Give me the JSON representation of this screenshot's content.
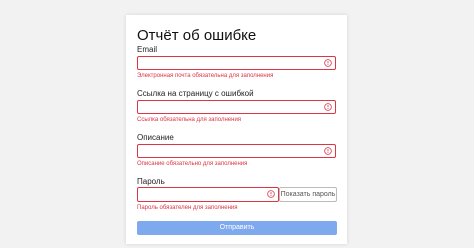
{
  "form": {
    "title": "Отчёт об ошибке",
    "fields": [
      {
        "label": "Email",
        "value": "",
        "error": "Электронная почта обязательна для заполнения",
        "icon": "error-circle-icon"
      },
      {
        "label": "Ссылка на страницу с ошибкой",
        "value": "",
        "error": "Ссылка обязательна для заполнения",
        "icon": "error-circle-icon"
      },
      {
        "label": "Описание",
        "value": "",
        "error": "Описание обязательно для заполнения",
        "icon": "error-circle-icon"
      },
      {
        "label": "Пароль",
        "value": "",
        "error": "Пароль обязателен для заполнения",
        "icon": "error-circle-icon"
      }
    ],
    "show_password_label": "Показать пароль",
    "submit_label": "Отправить"
  },
  "colors": {
    "error": "#dc3545",
    "submit_bg": "#7fa9ef",
    "page_bg": "#f2f2f2"
  }
}
